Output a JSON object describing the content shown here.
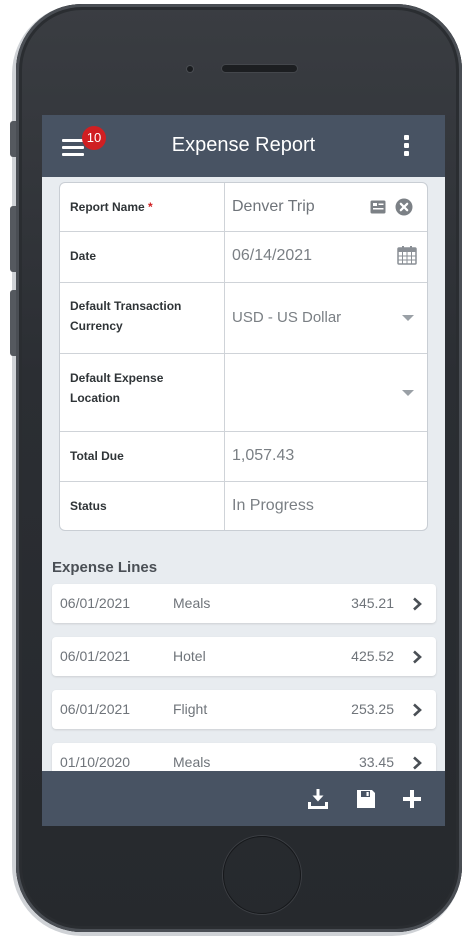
{
  "app": {
    "title": "Expense Report",
    "notification_count": "10"
  },
  "form": {
    "report_name": {
      "label": "Report Name",
      "required_mark": "*",
      "value": "Denver Trip"
    },
    "date": {
      "label": "Date",
      "value": "06/14/2021"
    },
    "currency": {
      "label": "Default Transaction Currency",
      "value": "USD - US Dollar"
    },
    "location": {
      "label": "Default Expense Location",
      "value": ""
    },
    "total_due": {
      "label": "Total Due",
      "value": "1,057.43"
    },
    "status": {
      "label": "Status",
      "value": "In Progress"
    }
  },
  "expense_lines": {
    "title": "Expense Lines",
    "items": [
      {
        "date": "06/01/2021",
        "category": "Meals",
        "amount": "345.21"
      },
      {
        "date": "06/01/2021",
        "category": "Hotel",
        "amount": "425.52"
      },
      {
        "date": "06/01/2021",
        "category": "Flight",
        "amount": "253.25"
      },
      {
        "date": "01/10/2020",
        "category": "Meals",
        "amount": "33.45"
      }
    ]
  },
  "icons": {
    "menu": "hamburger-menu-icon",
    "more": "more-vertical-icon",
    "contact_card": "id-card-icon",
    "clear": "clear-circle-icon",
    "calendar": "calendar-icon",
    "dropdown": "caret-down-icon",
    "chevron": "chevron-right-icon",
    "download": "download-icon",
    "save": "save-icon",
    "add": "plus-icon"
  },
  "colors": {
    "appbar": "#485363",
    "badge": "#d01f22",
    "required": "#d01f22",
    "background": "#e8ecf0"
  }
}
